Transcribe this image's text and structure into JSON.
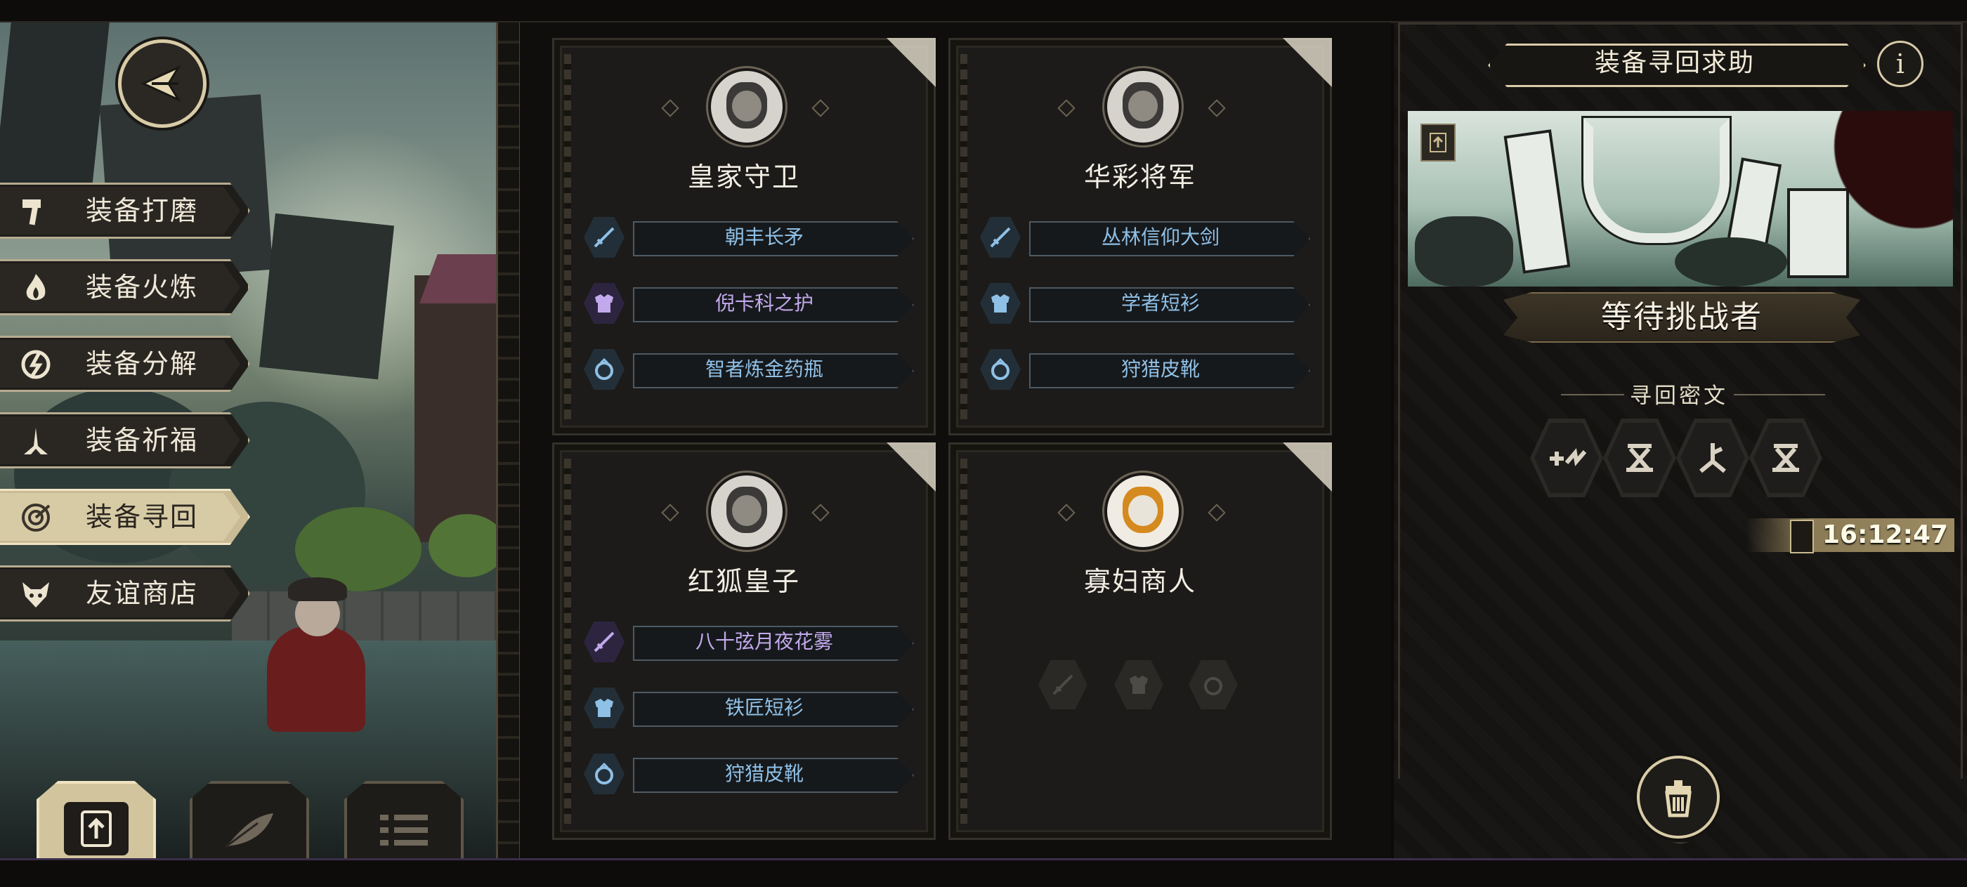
{
  "side_menu": {
    "items": [
      {
        "label": "装备打磨",
        "icon": "hammer-icon"
      },
      {
        "label": "装备火炼",
        "icon": "flame-icon"
      },
      {
        "label": "装备分解",
        "icon": "shatter-icon"
      },
      {
        "label": "装备祈福",
        "icon": "pray-icon"
      },
      {
        "label": "装备寻回",
        "icon": "target-icon",
        "active": true
      },
      {
        "label": "友谊商店",
        "icon": "fox-icon"
      }
    ]
  },
  "bottom_tabs": [
    {
      "icon": "upload-icon",
      "active": true
    },
    {
      "icon": "feather-icon",
      "active": false
    },
    {
      "icon": "list-icon",
      "active": false
    }
  ],
  "cards": [
    {
      "name": "皇家守卫",
      "equipment": [
        {
          "slot": "weapon",
          "label": "朝丰长矛",
          "rarity": "blue"
        },
        {
          "slot": "armor",
          "label": "倪卡科之护",
          "rarity": "purple"
        },
        {
          "slot": "accessory",
          "label": "智者炼金药瓶",
          "rarity": "blue"
        }
      ]
    },
    {
      "name": "华彩将军",
      "equipment": [
        {
          "slot": "weapon",
          "label": "丛林信仰大剑",
          "rarity": "blue"
        },
        {
          "slot": "armor",
          "label": "学者短衫",
          "rarity": "blue"
        },
        {
          "slot": "accessory",
          "label": "狩猎皮靴",
          "rarity": "blue"
        }
      ]
    },
    {
      "name": "红狐皇子",
      "equipment": [
        {
          "slot": "weapon",
          "label": "八十弦月夜花雾",
          "rarity": "purple"
        },
        {
          "slot": "armor",
          "label": "铁匠短衫",
          "rarity": "blue"
        },
        {
          "slot": "accessory",
          "label": "狩猎皮靴",
          "rarity": "blue"
        }
      ]
    },
    {
      "name": "寡妇商人",
      "equipment": []
    }
  ],
  "right_panel": {
    "title": "装备寻回求助",
    "info_icon_glyph": "i",
    "status": "等待挑战者",
    "cipher_title": "寻回密文",
    "cipher_symbols": [
      "cipher-rune-1-icon",
      "cipher-rune-2-icon",
      "cipher-rune-3-icon",
      "cipher-rune-4-icon"
    ],
    "timer": "16:12:47"
  },
  "colors": {
    "accent_gold": "#d8cba7",
    "equip_blue": "#8fc0e6",
    "equip_purple": "#c2a9ec",
    "panel_dark": "#1c1b19"
  }
}
